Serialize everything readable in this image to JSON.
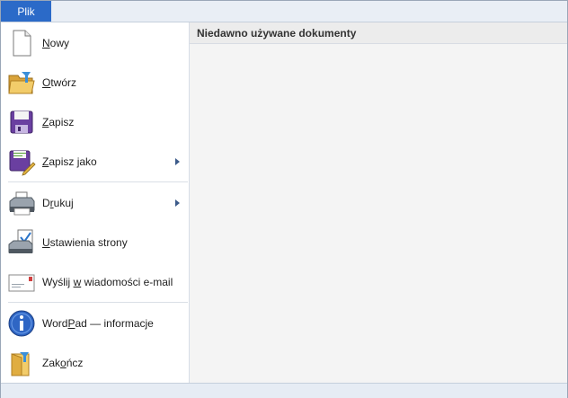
{
  "file_tab": "Plik",
  "recent": {
    "header": "Niedawno używane dokumenty"
  },
  "menu": [
    {
      "id": "new",
      "pre": "",
      "u": "N",
      "post": "owy",
      "icon": "new-document-icon",
      "submenu": false
    },
    {
      "id": "open",
      "pre": "",
      "u": "O",
      "post": "twórz",
      "icon": "open-folder-icon",
      "submenu": false
    },
    {
      "id": "save",
      "pre": "",
      "u": "Z",
      "post": "apisz",
      "icon": "save-floppy-icon",
      "submenu": false
    },
    {
      "id": "save-as",
      "pre": "",
      "u": "Z",
      "post": "apisz jako",
      "icon": "save-as-icon",
      "submenu": true
    },
    {
      "id": "print",
      "pre": "D",
      "u": "r",
      "post": "ukuj",
      "icon": "printer-icon",
      "submenu": true
    },
    {
      "id": "page-setup",
      "pre": "",
      "u": "U",
      "post": "stawienia strony",
      "icon": "page-setup-icon",
      "submenu": false
    },
    {
      "id": "send-email",
      "pre": "Wyślij ",
      "u": "w",
      "post": " wiadomości e-mail",
      "icon": "email-envelope-icon",
      "submenu": false
    },
    {
      "id": "about",
      "pre": "Word",
      "u": "P",
      "post": "ad — informacje",
      "icon": "info-icon",
      "submenu": false
    },
    {
      "id": "exit",
      "pre": "Zak",
      "u": "o",
      "post": "ńcz",
      "icon": "exit-icon",
      "submenu": false
    }
  ],
  "colors": {
    "file_tab_bg": "#2b6ac8",
    "arrow": "#3c5b8a"
  }
}
